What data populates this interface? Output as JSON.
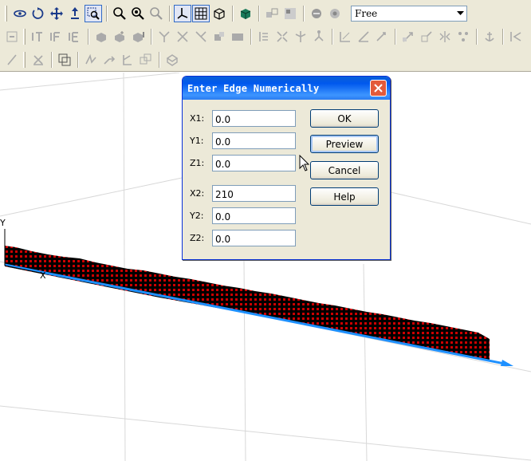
{
  "toolbar": {
    "view_mode_value": "Free",
    "colors": {
      "background": "#ece9d8",
      "active_border": "#316ac5"
    }
  },
  "dialog": {
    "title": "Enter Edge Numerically",
    "fields": [
      {
        "label": "X1:",
        "value": "0.0"
      },
      {
        "label": "Y1:",
        "value": "0.0"
      },
      {
        "label": "Z1:",
        "value": "0.0"
      },
      {
        "label": "X2:",
        "value": "210"
      },
      {
        "label": "Y2:",
        "value": "0.0"
      },
      {
        "label": "Z2:",
        "value": "0.0"
      }
    ],
    "buttons": {
      "ok": "OK",
      "preview": "Preview",
      "cancel": "Cancel",
      "help": "Help"
    },
    "colors": {
      "title_bar": "#0058ee",
      "close_button": "#e35a3a"
    }
  },
  "viewport": {
    "axis_y_label": "Y",
    "axis_x_label": "X",
    "colors": {
      "edge": "#1e90ff",
      "hatch_fill": "#cc0000",
      "hatch_grid": "#000000",
      "grid": "#d8d8d8"
    }
  }
}
